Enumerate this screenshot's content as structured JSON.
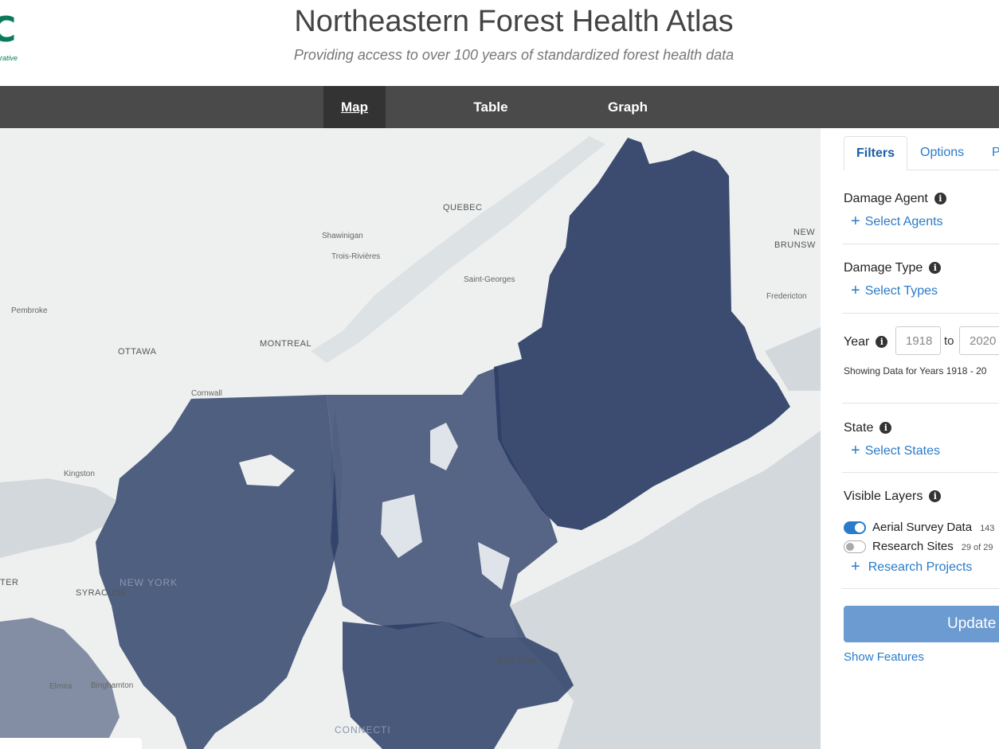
{
  "header": {
    "logo_mark": "C",
    "logo_sub": "rative",
    "title": "Northeastern Forest Health Atlas",
    "subtitle": "Providing access to over 100 years of standardized forest health data"
  },
  "nav": {
    "map": "Map",
    "table": "Table",
    "graph": "Graph"
  },
  "map": {
    "labels": {
      "quebec": "QUEBEC",
      "shawinigan": "Shawinigan",
      "trois_rivieres": "Trois-Rivières",
      "saint_georges": "Saint-Georges",
      "pembroke": "Pembroke",
      "ottawa": "OTTAWA",
      "montreal": "MONTREAL",
      "cornwall": "Cornwall",
      "kingston": "Kingston",
      "new": "NEW",
      "brunsw": "BRUNSW",
      "fredericton": "Fredericton",
      "syracuse": "SYRACUSE",
      "new_york": "NEW YORK",
      "boston": "BOSTON",
      "binghamton": "Binghamton",
      "elmira": "Elmira",
      "ter": "TER",
      "connecticut": "CONNECTI"
    },
    "colors": {
      "land": "#eef0f0",
      "water": "#d3d8dc",
      "data_fill": "#2c3e66"
    }
  },
  "sidebar": {
    "tabs": [
      "Filters",
      "Options",
      "P"
    ],
    "damage_agent": {
      "label": "Damage Agent",
      "action": "Select Agents"
    },
    "damage_type": {
      "label": "Damage Type",
      "action": "Select Types"
    },
    "year": {
      "label": "Year",
      "from_value": "1918",
      "to_label": "to",
      "to_value": "2020",
      "note": "Showing Data for Years 1918 - 20"
    },
    "state": {
      "label": "State",
      "action": "Select States"
    },
    "visible_layers": {
      "label": "Visible Layers",
      "aerial": {
        "label": "Aerial Survey Data",
        "count": "143",
        "enabled": true
      },
      "research": {
        "label": "Research Sites",
        "count": "29 of 29",
        "enabled": false
      },
      "projects_action": "Research Projects"
    },
    "update_label": "Update",
    "show_features": "Show Features"
  },
  "icons": {
    "info": "info-icon",
    "plus": "plus-icon"
  }
}
